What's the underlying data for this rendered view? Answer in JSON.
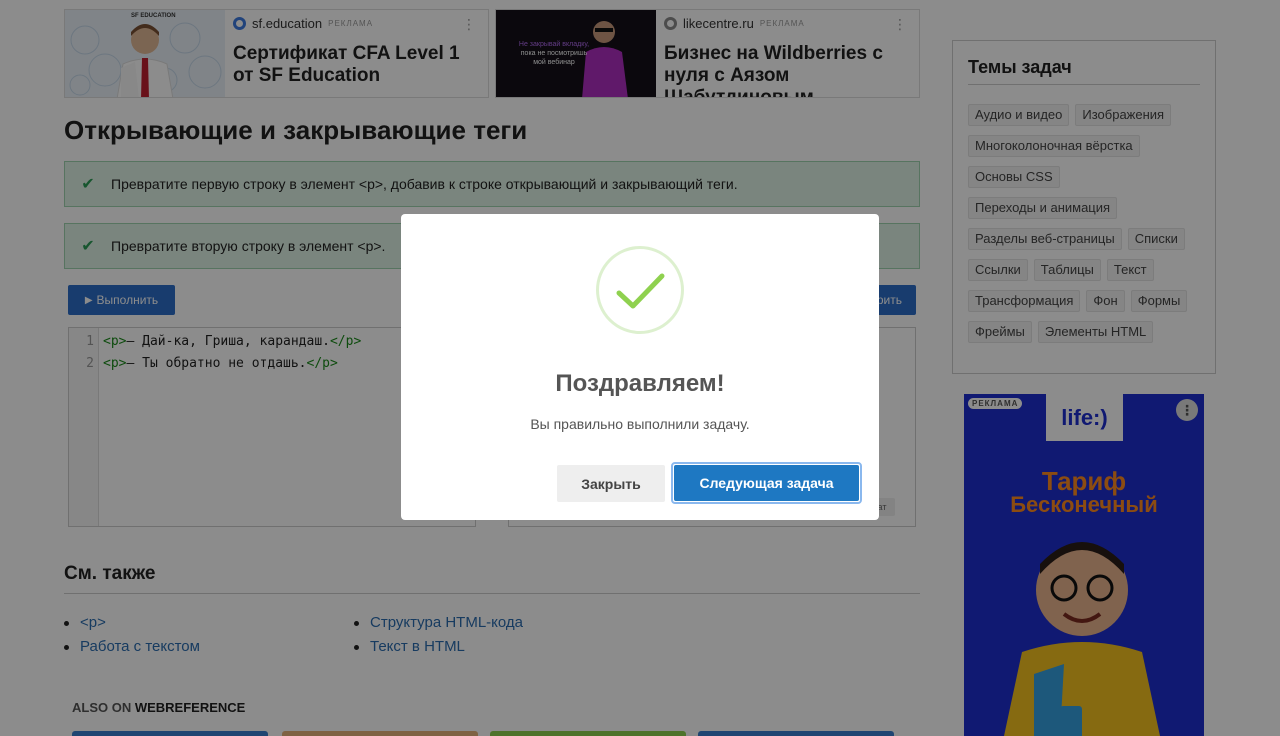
{
  "ads": [
    {
      "brand_logo_text": "SF EDUCATION",
      "advertiser": "sf.education",
      "tag": "РЕКЛАМА",
      "title": "Сертификат CFA Level 1 от SF Education",
      "menu": "⋮"
    },
    {
      "advertiser": "likecentre.ru",
      "tag": "РЕКЛАМА",
      "title": "Бизнес на Wildberries с нуля с Аязом Шабутдиновым",
      "menu": "⋮",
      "image_text": [
        "Не закрывай вкладку,",
        "пока не посмотришь",
        "мой вебинар"
      ]
    }
  ],
  "page": {
    "title": "Открывающие и закрывающие теги",
    "tasks": [
      {
        "text": "Превратите первую строку в элемент <p>, добавив к строке открывающий и закрывающий теги.",
        "check_icon": "✔"
      },
      {
        "text": "Превратите вторую строку в элемент <p>.",
        "check_icon": "✔"
      }
    ],
    "run_button": "Выполнить",
    "run_icon": "▶",
    "secondary_button": "рить",
    "result_chip": "ат",
    "editor": {
      "lines": [
        {
          "num": "1",
          "open": "<p>",
          "text": "— Дай-ка, Гриша, карандаш.",
          "close": "</p>"
        },
        {
          "num": "2",
          "open": "<p>",
          "text": "— Ты обратно не отдашь.",
          "close": "</p>"
        }
      ]
    },
    "see_also": {
      "title": "См. также",
      "col1": [
        "<p>",
        "Работа с текстом"
      ],
      "col2": [
        "Структура HTML-кода",
        "Текст в HTML"
      ]
    },
    "also_on": {
      "prefix": "ALSO ON ",
      "site": "WEBREFERENCE"
    }
  },
  "sidebar": {
    "topics_title": "Темы задач",
    "topics": [
      "Аудио и видео",
      "Изображения",
      "Многоколоночная вёрстка",
      "Основы CSS",
      "Переходы и анимация",
      "Разделы веб-страницы",
      "Списки",
      "Ссылки",
      "Таблицы",
      "Текст",
      "Трансформация",
      "Фон",
      "Формы",
      "Фреймы",
      "Элементы HTML"
    ],
    "ad": {
      "tag": "РЕКЛАМА",
      "menu": "⋮",
      "logo": "life:)",
      "line1": "Тариф",
      "line2": "Бесконечный"
    }
  },
  "modal": {
    "title": "Поздравляем!",
    "text": "Вы правильно выполнили задачу.",
    "close_button": "Закрыть",
    "next_button": "Следующая задача"
  },
  "colors": {
    "accent_blue": "#1e78c2",
    "task_done_bg": "#dff2e5",
    "success_check": "#8fd14f",
    "link": "#2b6cb0"
  }
}
